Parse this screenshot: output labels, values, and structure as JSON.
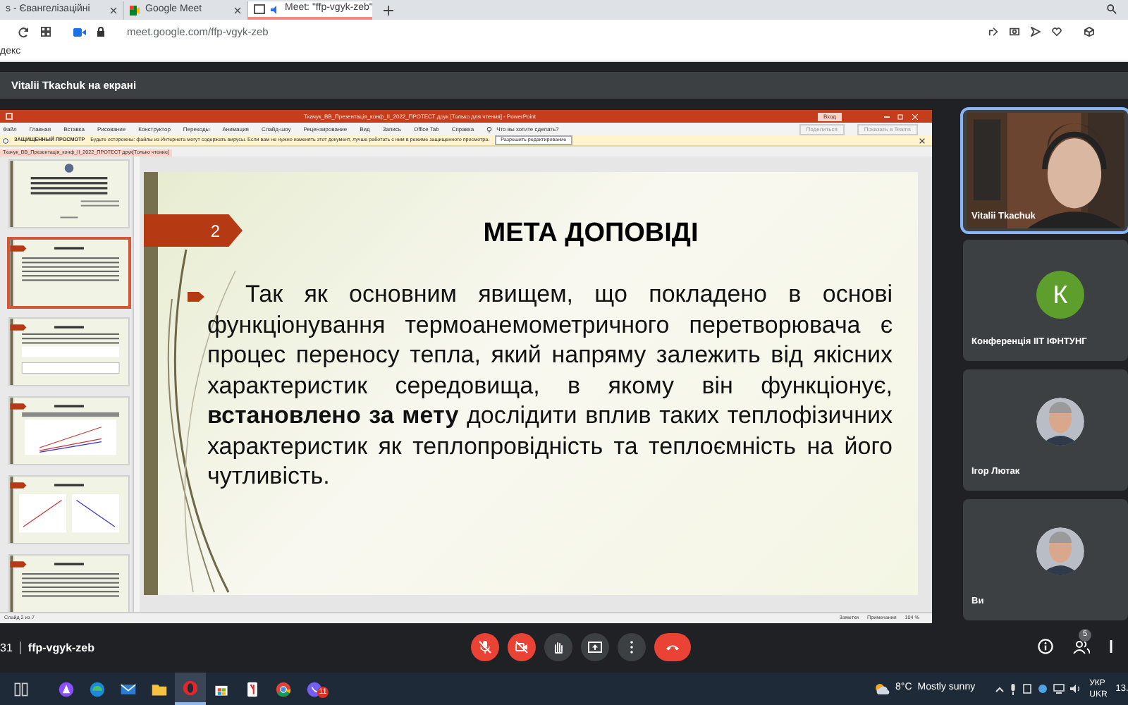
{
  "browser": {
    "tabs": [
      {
        "title": "s - Євангелізаційні",
        "kind": "page",
        "selected": false
      },
      {
        "title": "Google Meet",
        "kind": "meet",
        "selected": false
      },
      {
        "title": "Meet: \"ffp-vgyk-zeb\"",
        "kind": "meet",
        "selected": true
      }
    ],
    "address": "meet.google.com/ffp-vgyk-zeb",
    "bookmark": "декс"
  },
  "meet": {
    "banner": "Vitalii Tkachuk на екрані",
    "time": "31",
    "meeting_code": "ffp-vgyk-zeb",
    "participants_count": "5",
    "controls": [
      {
        "kind": "mic",
        "on": false
      },
      {
        "kind": "camera",
        "on": false
      },
      {
        "kind": "hand"
      },
      {
        "kind": "present"
      },
      {
        "kind": "more"
      },
      {
        "kind": "leave"
      }
    ],
    "tiles": [
      {
        "kind": "video",
        "name": "Vitalii Tkachuk",
        "speaking": true
      },
      {
        "kind": "letter",
        "name": "Конференція ІІТ ІФНТУНГ",
        "letter": "К",
        "speaking": false
      },
      {
        "name": "Ігор Лютак",
        "speaking": false
      },
      {
        "name": "Ви",
        "speaking": false
      }
    ]
  },
  "powerpoint": {
    "title": "Ткачук_ВВ_Презентація_конф_ІІ_2022_ПРОТЕСТ друк [Только для чтения] - PowerPoint",
    "login": "Вход",
    "ribbon_tabs": [
      "Файл",
      "Главная",
      "Вставка",
      "Рисование",
      "Конструктор",
      "Переходы",
      "Анимация",
      "Слайд-шоу",
      "Рецензирование",
      "Вид",
      "Запись",
      "Office Tab",
      "Справка"
    ],
    "tell_me": "Что вы хотите сделать?",
    "share": "Поделиться",
    "teams": "Показать в Teams",
    "protected_view": {
      "label": "ЗАЩИЩЕННЫЙ ПРОСМОТР",
      "message": "Будьте осторожны: файлы из Интернета могут содержать вирусы. Если вам не нужно изменять этот документ, лучше работать с ним в режиме защищенного просмотра.",
      "button": "Разрешить редактирование"
    },
    "doc_tab": "Ткачук_ВВ_Презентація_конф_ІІ_2022_ПРОТЕСТ друк[Только чтение]",
    "thumbnails": [
      {
        "kind": "title",
        "selected": false
      },
      {
        "kind": "text",
        "selected": true
      },
      {
        "kind": "table",
        "selected": false
      },
      {
        "kind": "chart",
        "selected": false
      },
      {
        "kind": "charts",
        "selected": false
      },
      {
        "kind": "text",
        "selected": false
      }
    ],
    "slide": {
      "number": "2",
      "title": "МЕТА ДОПОВІДІ",
      "body": "Так як основним явищем, що покладено в основі функціонування термоанемометричного перетворювача є процес переносу тепла, який напряму залежить від якісних характеристик середовища, в якому він функціонує, **встановлено за мету** дослідити вплив таких теплофізичних характеристик як теплопровідність та теплоємність на його чутливість."
    },
    "status": {
      "slide": "Слайд 2 из 7",
      "notes": "Заметки",
      "comments": "Примечания",
      "zoom": "104 %"
    }
  },
  "taskbar": {
    "apps": [
      {
        "kind": "taskview",
        "active": false
      },
      {
        "kind": "alice",
        "active": false
      },
      {
        "kind": "edge",
        "active": false
      },
      {
        "kind": "mail",
        "active": false
      },
      {
        "kind": "folder",
        "active": false
      },
      {
        "kind": "opera",
        "active": true
      },
      {
        "kind": "store",
        "active": false
      },
      {
        "kind": "yandex",
        "active": false
      },
      {
        "kind": "chrome",
        "active": false
      },
      {
        "kind": "viber",
        "active": false,
        "badge": "11"
      }
    ],
    "temperature": "8°C",
    "weather": "Mostly sunny",
    "lang_top": "УКР",
    "lang_bottom": "UKR",
    "clock": "13."
  }
}
